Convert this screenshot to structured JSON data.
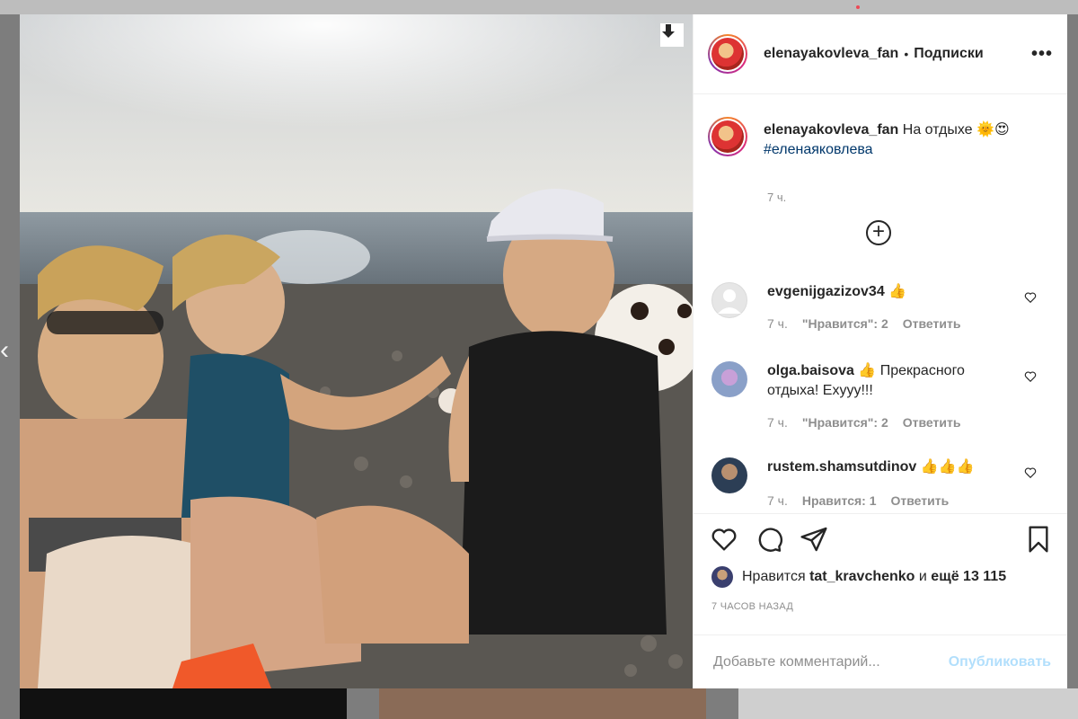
{
  "post": {
    "author": "elenayakovleva_fan",
    "separator": "•",
    "follow_label": "Подписки",
    "more_label": "•••"
  },
  "caption": {
    "user": "elenayakovleva_fan",
    "text": " На отдыхе 🌞😍",
    "hashtag": "#еленаяковлева",
    "time": "7 ч."
  },
  "load_more_label": "+",
  "comments": [
    {
      "user": "evgenijgazizov34",
      "text": " 👍",
      "time": "7 ч.",
      "likes": "\"Нравится\": 2",
      "reply": "Ответить"
    },
    {
      "user": "olga.baisova",
      "text": " 👍 Прекрасного отдыха! Ехууу!!!",
      "time": "7 ч.",
      "likes": "\"Нравится\": 2",
      "reply": "Ответить"
    },
    {
      "user": "rustem.shamsutdinov",
      "text": " 👍👍👍",
      "time": "7 ч.",
      "likes": "Нравится: 1",
      "reply": "Ответить"
    }
  ],
  "likes": {
    "prefix": "Нравится",
    "user": "tat_kravchenko",
    "middle": "и",
    "count": "ещё 13 115"
  },
  "time_ago": "7 ЧАСОВ НАЗАД",
  "comment_input": {
    "placeholder": "Добавьте комментарий...",
    "value": ""
  },
  "publish_label": "Опубликовать",
  "icons": {
    "download": "download-icon",
    "heart": "heart-icon",
    "comment": "comment-icon",
    "share": "share-icon",
    "save": "bookmark-icon"
  },
  "colors": {
    "link": "#00376b",
    "muted": "#8e8e8e",
    "publish_disabled": "#b2dffc"
  }
}
